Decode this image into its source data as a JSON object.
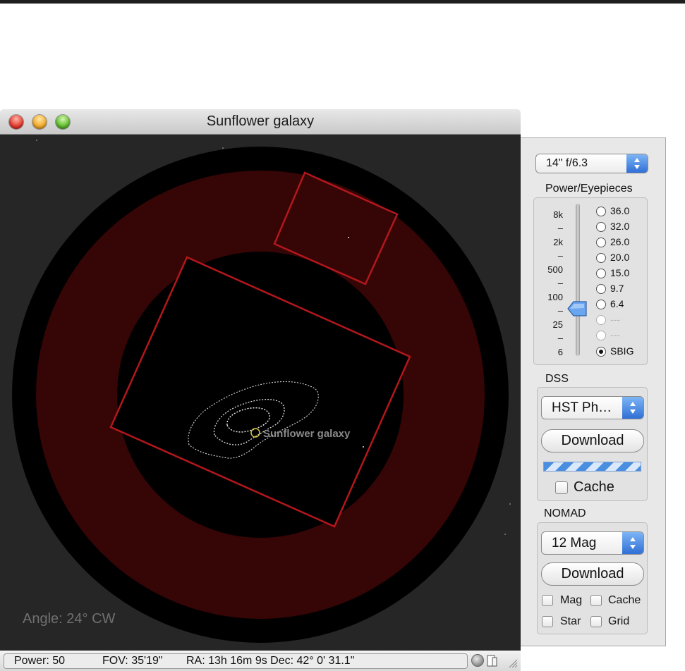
{
  "window": {
    "title": "Sunflower galaxy"
  },
  "view": {
    "object_label": "Sunflower galaxy",
    "angle_text": "Angle: 24° CW",
    "rotation_deg": 24
  },
  "status": {
    "power": "Power: 50",
    "fov": "FOV: 35'19\"",
    "coords": "RA: 13h 16m 9s Dec: 42° 0' 31.1\""
  },
  "panel": {
    "telescope": "14\" f/6.3",
    "power_section": "Power/Eyepieces",
    "scale": [
      "8k",
      "–",
      "2k",
      "–",
      "500",
      "–",
      "100",
      "–",
      "25",
      "–",
      "6"
    ],
    "eyepieces": [
      {
        "label": "36.0",
        "state": "normal"
      },
      {
        "label": "32.0",
        "state": "normal"
      },
      {
        "label": "26.0",
        "state": "normal"
      },
      {
        "label": "20.0",
        "state": "normal"
      },
      {
        "label": "15.0",
        "state": "normal"
      },
      {
        "label": "9.7",
        "state": "normal"
      },
      {
        "label": "6.4",
        "state": "normal"
      },
      {
        "label": "---",
        "state": "disabled"
      },
      {
        "label": "---",
        "state": "disabled"
      },
      {
        "label": "SBIG",
        "state": "selected"
      }
    ],
    "dss": {
      "title": "DSS",
      "survey": "HST Ph…",
      "download": "Download",
      "cache": "Cache"
    },
    "nomad": {
      "title": "NOMAD",
      "mag": "12 Mag",
      "download": "Download",
      "mag_check": "Mag",
      "cache_check": "Cache",
      "star_check": "Star",
      "grid_check": "Grid"
    }
  },
  "colors": {
    "fov_ring": "#360506",
    "frame_red": "#b3171c",
    "background": "#262626"
  }
}
